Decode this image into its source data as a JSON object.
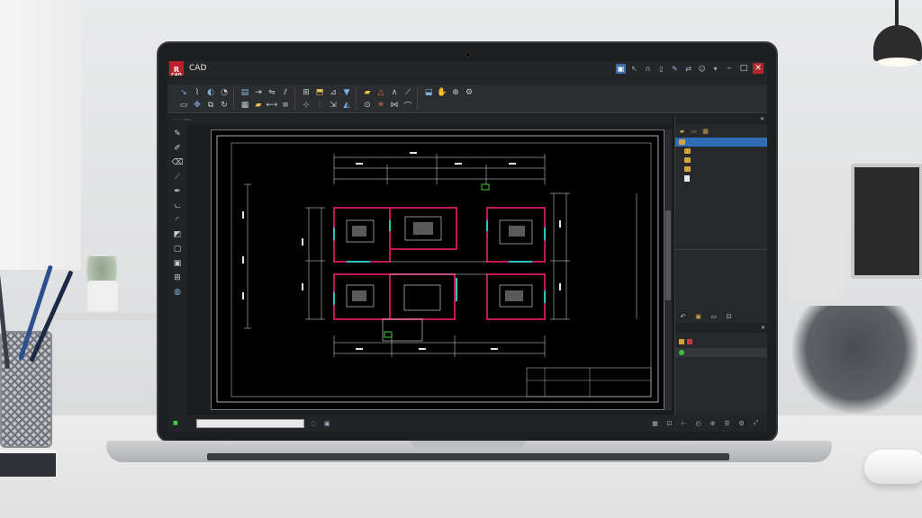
{
  "app": {
    "logo_text": "CAD",
    "title": "CAD"
  },
  "ribbon_tabs": [
    "",
    "",
    "",
    "",
    "",
    "",
    "",
    "",
    "",
    ""
  ],
  "doc_tabs": [
    "",
    ""
  ],
  "right_panel": {
    "tree_header": "",
    "tree_items": [
      {
        "label": "",
        "type": "folder",
        "selected": true
      },
      {
        "label": "",
        "type": "folder",
        "selected": false
      },
      {
        "label": "",
        "type": "folder",
        "selected": false
      },
      {
        "label": "",
        "type": "folder",
        "selected": false
      },
      {
        "label": "",
        "type": "file",
        "selected": false
      }
    ],
    "layers_header": "",
    "layers": [
      {
        "label": "",
        "color": "#d6a23b"
      },
      {
        "label": "",
        "color": "#3cc23c"
      }
    ]
  },
  "status": {
    "items": [
      "",
      "",
      "",
      ""
    ]
  },
  "colors": {
    "accent": "#2f6db5",
    "logo": "#b7202c",
    "wall_lines": "#c2185b",
    "door_lines": "#27c4c0",
    "dimension_lines": "#e6e6e6",
    "grid_marker": "#3fd13f"
  },
  "icons": {
    "title_tools": [
      "select-icon",
      "pointer-icon",
      "magnet-icon",
      "phone-icon",
      "tool-icon",
      "share-icon",
      "user-icon"
    ],
    "ribbon": [
      "line-icon",
      "polyline-icon",
      "circle-icon",
      "arc-icon",
      "rectangle-icon",
      "move-icon",
      "copy-icon",
      "rotate-icon",
      "trim-icon",
      "extend-icon",
      "mirror-icon",
      "offset-icon",
      "hatch-icon",
      "text-icon",
      "dimension-icon",
      "layer-icon",
      "block-icon",
      "insert-icon",
      "measure-icon",
      "properties-icon"
    ],
    "left_toolbar": [
      "pencil-icon",
      "brush-icon",
      "eraser-icon",
      "ruler-icon",
      "pen-icon",
      "compass-icon",
      "arc-tool-icon",
      "fill-icon",
      "frame-icon",
      "image-icon",
      "grid-icon",
      "globe-icon"
    ]
  }
}
